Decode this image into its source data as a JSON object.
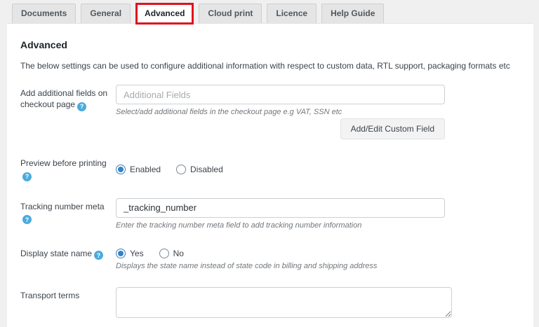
{
  "tabs": [
    {
      "label": "Documents",
      "active": false
    },
    {
      "label": "General",
      "active": false
    },
    {
      "label": "Advanced",
      "active": true
    },
    {
      "label": "Cloud print",
      "active": false
    },
    {
      "label": "Licence",
      "active": false
    },
    {
      "label": "Help Guide",
      "active": false
    }
  ],
  "page": {
    "heading": "Advanced",
    "description": "The below settings can be used to configure additional information with respect to custom data, RTL support, packaging formats etc"
  },
  "icons": {
    "help_glyph": "?"
  },
  "fields": {
    "additional_fields": {
      "label": "Add additional fields on checkout page",
      "placeholder": "Additional Fields",
      "helper": "Select/add additional fields in the checkout page e.g VAT, SSN etc",
      "button_label": "Add/Edit Custom Field"
    },
    "preview_before_printing": {
      "label": "Preview before printing",
      "options": [
        {
          "label": "Enabled",
          "checked": true
        },
        {
          "label": "Disabled",
          "checked": false
        }
      ]
    },
    "tracking_number_meta": {
      "label": "Tracking number meta",
      "value": "_tracking_number",
      "helper": "Enter the tracking number meta field to add tracking number information"
    },
    "display_state_name": {
      "label": "Display state name",
      "options": [
        {
          "label": "Yes",
          "checked": true
        },
        {
          "label": "No",
          "checked": false
        }
      ],
      "helper": "Displays the state name instead of state code in billing and shipping address"
    },
    "transport_terms": {
      "label": "Transport terms",
      "value": ""
    }
  },
  "colors": {
    "annotation_red": "#e0131c",
    "help_blue": "#4aabdd",
    "radio_blue": "#3582c4",
    "page_bg": "#f0f0f1"
  }
}
